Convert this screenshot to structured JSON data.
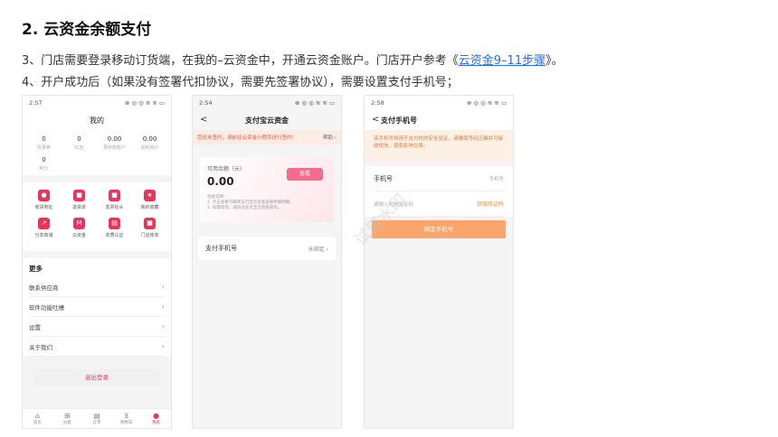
{
  "doc": {
    "title": "2. 云资金余额支付",
    "line1_pre": "3、门店需要登录移动订货端，在我的–云资金中，开通云资金账户。门店开户参考《",
    "line1_link": "云资金9–11步骤",
    "line1_post": "》。",
    "line2": "4、开户成功后（如果没有签署代扣协议，需要先签署协议），需要设置支付手机号；"
  },
  "phone1": {
    "time": "2:57",
    "status_icons": "⊗ ◎ ◎ ≋ ≋ ▭",
    "title": "我的",
    "stats": [
      {
        "value": "0",
        "label": "优惠券"
      },
      {
        "value": "0",
        "label": "红包"
      },
      {
        "value": "0.00",
        "label": "预存款账户"
      },
      {
        "value": "0.00",
        "label": "返利账户"
      }
    ],
    "stat5": {
      "value": "0",
      "label": "积分"
    },
    "grid": [
      {
        "icon": "●",
        "label": "收货地址"
      },
      {
        "icon": "■",
        "label": "退货单"
      },
      {
        "icon": "■",
        "label": "发票抬头"
      },
      {
        "icon": "★",
        "label": "我的收藏"
      },
      {
        "icon": "↗",
        "label": "分享商城"
      },
      {
        "icon": "M",
        "label": "云资金"
      },
      {
        "icon": "▤",
        "label": "资质认证"
      },
      {
        "icon": "■",
        "label": "门店账单"
      }
    ],
    "more_title": "更多",
    "more_items": [
      "联系供应商",
      "软件功能吐槽",
      "设置",
      "关于我们"
    ],
    "logout": "退出登录",
    "tabs": [
      {
        "icon": "⌂",
        "label": "首页"
      },
      {
        "icon": "⊞",
        "label": "分类"
      },
      {
        "icon": "▤",
        "label": "订单"
      },
      {
        "icon": "⊻",
        "label": "购物车"
      },
      {
        "icon": "●",
        "label": "我的"
      }
    ]
  },
  "phone2": {
    "time": "2:54",
    "status_icons": "⊗ ◎ ◎ ≋ ≋ ▭",
    "back": "<",
    "title": "支付宝云资金",
    "banner_text": "您还未签约，请前往云资金小程序进行签约！",
    "banner_help": "帮助 ›",
    "balance_label": "可用余额（元）",
    "balance_value": "0.00",
    "view_button": "查看",
    "note_title": "资金说明：",
    "note_1": "1. 点击查看可跳转支付宝云资金查看余额明细。",
    "note_2": "2. 如需提现，请前往支付宝云资金操作。",
    "phone_label": "支付手机号",
    "phone_status": "未绑定 ›"
  },
  "phone3": {
    "time": "2:58",
    "status_icons": "⊗ ◎ ◎ ≋ ≋ ▭",
    "back": "<",
    "title": "支付手机号",
    "warning": "该手机号将用于支付时的安全验证，请确保号码正确并可接收短信，避免影响交易。",
    "phone_label": "手机号",
    "phone_placeholder": "手机号",
    "code_placeholder": "请输入短信验证码",
    "get_code": "获取验证码",
    "bind_button": "绑定手机号"
  },
  "watermark": "试用水印"
}
